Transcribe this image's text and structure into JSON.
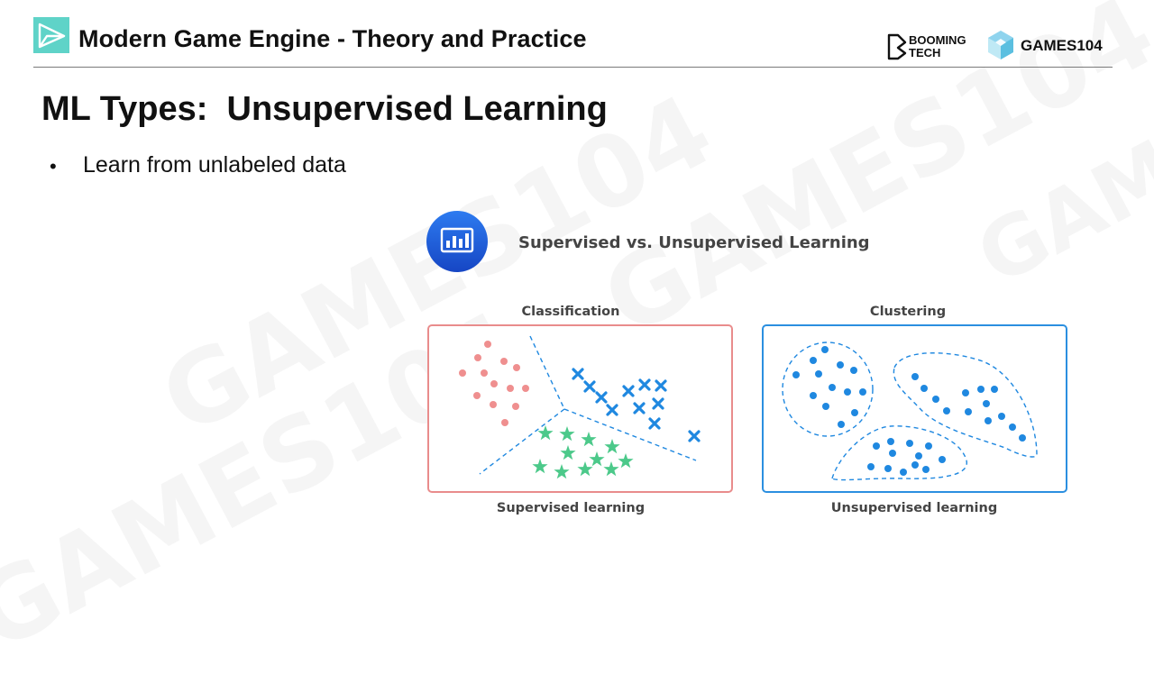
{
  "header": {
    "title": "Modern Game Engine - Theory and Practice",
    "logo_icon": "paper-plane-icon",
    "accent_color": "#5fd3c8",
    "brand_booming_line1": "BOOMING",
    "brand_booming_line2": "TECH",
    "brand_games": "GAMES104"
  },
  "slide": {
    "heading": "ML Types:  Unsupervised Learning",
    "bullets": [
      {
        "marker": "•",
        "text": "Learn from unlabeled data"
      }
    ]
  },
  "figure": {
    "title": "Supervised vs. Unsupervised Learning",
    "title_icon": "bar-chart-icon",
    "left_panel": {
      "heading": "Classification",
      "caption": "Supervised learning",
      "border_color": "#e98c8c"
    },
    "right_panel": {
      "heading": "Clustering",
      "caption": "Unsupervised learning",
      "border_color": "#2b8fe0"
    },
    "colors": {
      "pink": "#ef8f8f",
      "blue": "#1f88e0",
      "green": "#4cc98a"
    }
  }
}
